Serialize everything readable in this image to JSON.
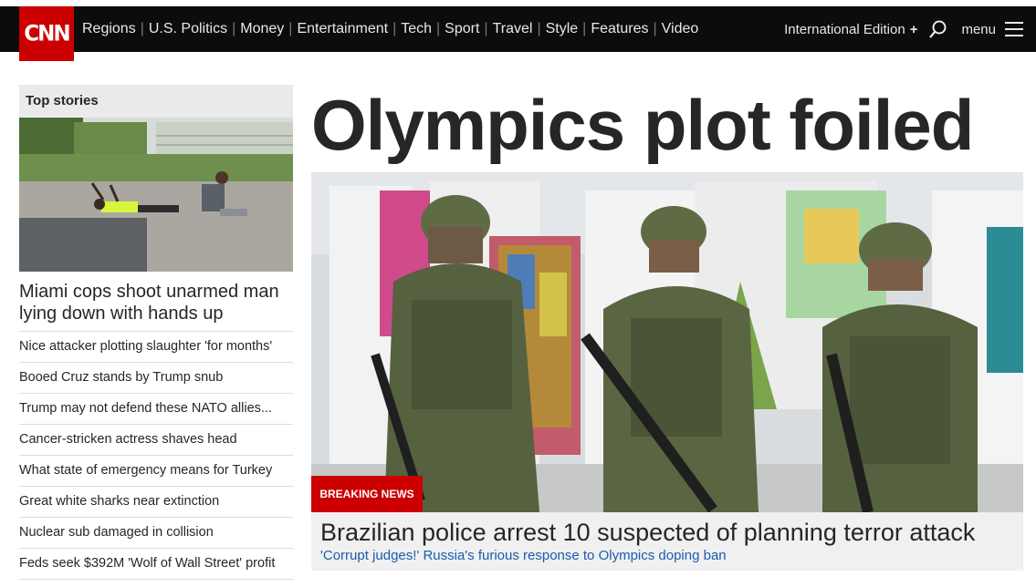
{
  "nav": {
    "logo": "CNN",
    "items": [
      "Regions",
      "U.S. Politics",
      "Money",
      "Entertainment",
      "Tech",
      "Sport",
      "Travel",
      "Style",
      "Features",
      "Video"
    ],
    "edition": "International Edition",
    "edition_plus": "+",
    "menu": "menu"
  },
  "top_stories": {
    "header": "Top stories",
    "lead": "Miami cops shoot unarmed man lying down with hands up",
    "items": [
      "Nice attacker plotting slaughter 'for months'",
      "Booed Cruz stands by Trump snub",
      "Trump may not defend these NATO allies...",
      "Cancer-stricken actress shaves head",
      "What state of emergency means for Turkey",
      "Great white sharks near extinction",
      "Nuclear sub damaged in collision",
      "Feds seek $392M 'Wolf of Wall Street' profit"
    ]
  },
  "main": {
    "headline": "Olympics plot foiled",
    "badge": "BREAKING NEWS",
    "caption_title": "Brazilian police arrest 10 suspected of planning terror attack",
    "caption_sub": "'Corrupt judges!' Russia's furious response to Olympics doping ban"
  },
  "colors": {
    "brand": "#cc0000",
    "nav_bg": "#0c0c0c",
    "link": "#1a5db0"
  }
}
